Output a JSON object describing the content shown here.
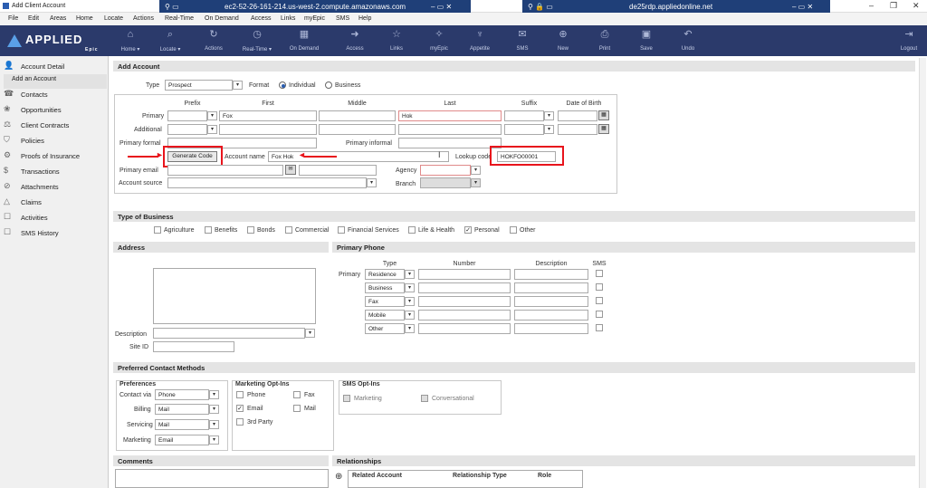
{
  "window": {
    "title": "Add Client Account"
  },
  "rdp_tabs": [
    {
      "host": "ec2-52-26-161-214.us-west-2.compute.amazonaws.com"
    },
    {
      "host": "de25rdp.appliedonline.net"
    }
  ],
  "menu": [
    "File",
    "Edit",
    "Areas",
    "Home",
    "Locate",
    "Actions",
    "Real-Time",
    "On Demand",
    "Access",
    "Links",
    "myEpic",
    "SMS",
    "Help"
  ],
  "brand": {
    "name": "APPLIED",
    "sub": "Epic",
    "accent": "#2b3a6b"
  },
  "toolbar": [
    {
      "label": "Home ▾",
      "icon": "home-icon"
    },
    {
      "label": "Locate ▾",
      "icon": "search-icon"
    },
    {
      "label": "Actions",
      "icon": "actions-icon"
    },
    {
      "label": "Real-Time ▾",
      "icon": "clock-icon"
    },
    {
      "label": "On Demand",
      "icon": "calendar-icon"
    },
    {
      "label": "Access",
      "icon": "access-icon"
    },
    {
      "label": "Links",
      "icon": "star-icon"
    },
    {
      "label": "myEpic",
      "icon": "myepic-icon"
    },
    {
      "label": "Appetite",
      "icon": "appetite-icon"
    },
    {
      "label": "SMS",
      "icon": "sms-icon"
    },
    {
      "label": "New",
      "icon": "new-icon"
    },
    {
      "label": "Print",
      "icon": "print-icon"
    },
    {
      "label": "Save",
      "icon": "save-icon"
    },
    {
      "label": "Undo",
      "icon": "undo-icon"
    },
    {
      "label": "Logout",
      "icon": "logout-icon"
    }
  ],
  "sidebar": {
    "items": [
      {
        "label": "Account Detail",
        "icon": "person-icon"
      },
      {
        "label": "Add an Account",
        "icon": ""
      },
      {
        "label": "Contacts",
        "icon": "contacts-icon"
      },
      {
        "label": "Opportunities",
        "icon": "opportunities-icon"
      },
      {
        "label": "Client Contracts",
        "icon": "contracts-icon"
      },
      {
        "label": "Policies",
        "icon": "shield-icon"
      },
      {
        "label": "Proofs of Insurance",
        "icon": "proofs-icon"
      },
      {
        "label": "Transactions",
        "icon": "dollar-icon"
      },
      {
        "label": "Attachments",
        "icon": "paperclip-icon"
      },
      {
        "label": "Claims",
        "icon": "claims-icon"
      },
      {
        "label": "Activities",
        "icon": "activities-icon"
      },
      {
        "label": "SMS History",
        "icon": "sms-icon"
      }
    ]
  },
  "add_account": {
    "title": "Add Account",
    "type_label": "Type",
    "type_value": "Prospect",
    "format_label": "Format",
    "format_options": [
      "Individual",
      "Business"
    ],
    "format_selected": "Individual"
  },
  "name": {
    "columns": [
      "Prefix",
      "First",
      "Middle",
      "Last",
      "Suffix",
      "Date of Birth"
    ],
    "row_labels": [
      "Primary",
      "Additional"
    ],
    "primary_first": "Fox",
    "primary_last": "Hok",
    "primary_formal_label": "Primary formal",
    "primary_informal_label": "Primary informal"
  },
  "account": {
    "generate_code_label": "Generate Code",
    "account_name_label": "Account name",
    "account_name_value": "Fox Hok",
    "lookup_code_label": "Lookup code",
    "lookup_code_value": "HOKFO00001",
    "primary_email_label": "Primary email",
    "account_source_label": "Account source",
    "agency_label": "Agency",
    "branch_label": "Branch"
  },
  "type_of_business": {
    "title": "Type of Business",
    "options": [
      {
        "label": "Agriculture",
        "checked": false
      },
      {
        "label": "Benefits",
        "checked": false
      },
      {
        "label": "Bonds",
        "checked": false
      },
      {
        "label": "Commercial",
        "checked": false
      },
      {
        "label": "Financial Services",
        "checked": false
      },
      {
        "label": "Life & Health",
        "checked": false
      },
      {
        "label": "Personal",
        "checked": true
      },
      {
        "label": "Other",
        "checked": false
      }
    ]
  },
  "address": {
    "title": "Address",
    "description_label": "Description",
    "site_id_label": "Site ID"
  },
  "phone": {
    "title": "Primary Phone",
    "columns": [
      "Type",
      "Number",
      "Description",
      "SMS"
    ],
    "row_label": "Primary",
    "types": [
      "Residence",
      "Business",
      "Fax",
      "Mobile",
      "Other"
    ]
  },
  "contact_methods": {
    "title": "Preferred Contact Methods",
    "preferences_title": "Preferences",
    "prefs": [
      {
        "label": "Contact via",
        "value": "Phone"
      },
      {
        "label": "Billing",
        "value": "Mail"
      },
      {
        "label": "Servicing",
        "value": "Mail"
      },
      {
        "label": "Marketing",
        "value": "Email"
      }
    ],
    "marketing_title": "Marketing Opt-Ins",
    "marketing": [
      {
        "label": "Phone",
        "checked": false
      },
      {
        "label": "Fax",
        "checked": false
      },
      {
        "label": "Email",
        "checked": true
      },
      {
        "label": "Mail",
        "checked": false
      },
      {
        "label": "3rd Party",
        "checked": false
      }
    ],
    "sms_title": "SMS Opt-Ins",
    "sms": [
      {
        "label": "Marketing",
        "checked": false
      },
      {
        "label": "Conversational",
        "checked": false
      }
    ]
  },
  "comments": {
    "title": "Comments"
  },
  "relationships": {
    "title": "Relationships",
    "columns": [
      "Related Account",
      "Relationship Type",
      "Role"
    ]
  },
  "colors": {
    "highlight": "#e8141c",
    "toolbar": "#2b3a6b",
    "rdp_bar": "#1f3f78"
  }
}
